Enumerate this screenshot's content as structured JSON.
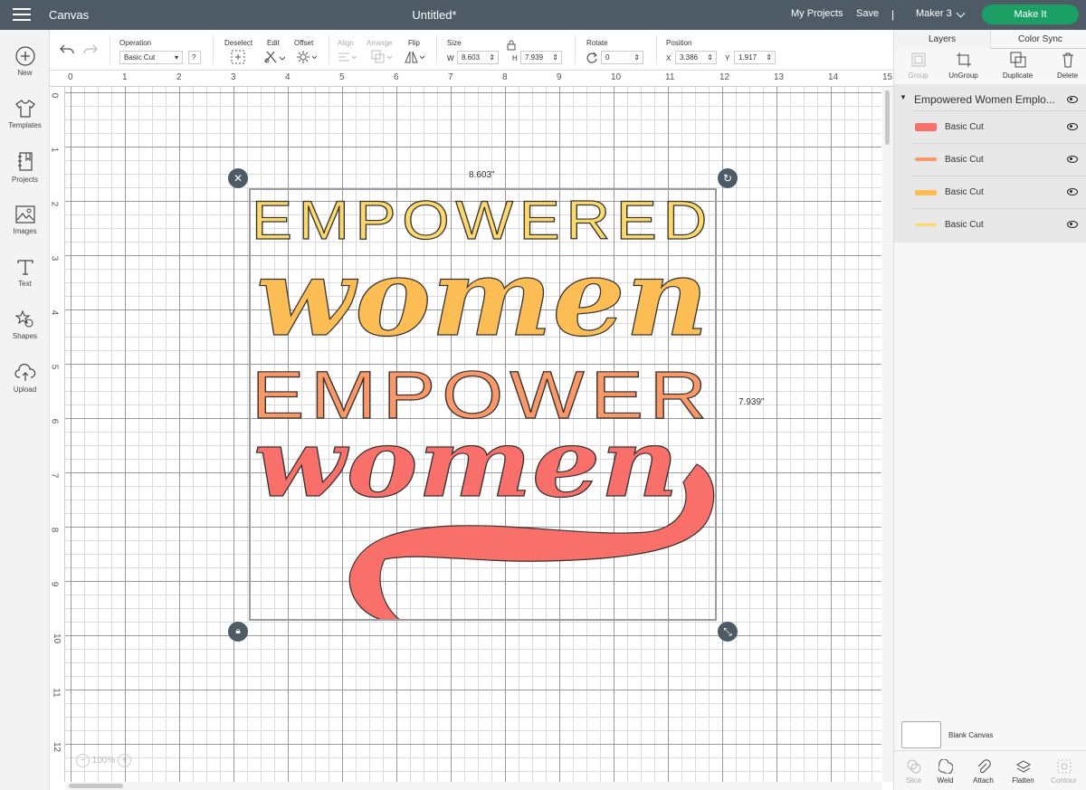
{
  "topbar": {
    "app_name": "Canvas",
    "doc_title": "Untitled*",
    "my_projects": "My Projects",
    "save": "Save",
    "separator": "|",
    "machine": "Maker 3",
    "make_it": "Make It"
  },
  "leftbar": {
    "items": [
      {
        "label": "New",
        "icon": "plus-icon"
      },
      {
        "label": "Templates",
        "icon": "tshirt-icon"
      },
      {
        "label": "Projects",
        "icon": "notebook-icon"
      },
      {
        "label": "Images",
        "icon": "image-icon"
      },
      {
        "label": "Text",
        "icon": "text-icon"
      },
      {
        "label": "Shapes",
        "icon": "shapes-icon"
      },
      {
        "label": "Upload",
        "icon": "upload-icon"
      }
    ]
  },
  "toolbar": {
    "operation_label": "Operation",
    "operation_value": "Basic Cut",
    "help": "?",
    "deselect_label": "Deselect",
    "edit_label": "Edit",
    "offset_label": "Offset",
    "align_label": "Align",
    "arrange_label": "Arrange",
    "flip_label": "Flip",
    "size_label": "Size",
    "w_label": "W",
    "w_value": "8.603",
    "h_label": "H",
    "h_value": "7.939",
    "rotate_label": "Rotate",
    "rotate_value": "0",
    "position_label": "Position",
    "x_label": "X",
    "x_value": "3.386",
    "y_label": "Y",
    "y_value": "1.917"
  },
  "rulers": {
    "h": [
      "0",
      "1",
      "2",
      "3",
      "4",
      "5",
      "6",
      "7",
      "8",
      "9",
      "10",
      "11",
      "12",
      "13",
      "14",
      "15"
    ],
    "v": [
      "0",
      "1",
      "2",
      "3",
      "4",
      "5",
      "6",
      "7",
      "8",
      "9",
      "10",
      "11",
      "12"
    ]
  },
  "canvas": {
    "width_dim": "8.603\"",
    "height_dim": "7.939\"",
    "zoom": "100%",
    "zoom_out": "−",
    "zoom_in": "+",
    "design": {
      "line1": "EMPOWERED",
      "line2": "women",
      "line3": "EMPOWER",
      "line4": "women",
      "colors": {
        "yellow": "#fcd96a",
        "orange": "#fcbd55",
        "peach": "#fb9868",
        "coral": "#f9706a"
      }
    }
  },
  "panel": {
    "tab_layers": "Layers",
    "tab_color_sync": "Color Sync",
    "actions": [
      {
        "label": "Group",
        "enabled": false
      },
      {
        "label": "UnGroup",
        "enabled": true
      },
      {
        "label": "Duplicate",
        "enabled": true
      },
      {
        "label": "Delete",
        "enabled": true
      }
    ],
    "group_name": "Empowered Women Emplo...",
    "layers": [
      {
        "label": "Basic Cut",
        "color": "#f9706a"
      },
      {
        "label": "Basic Cut",
        "color": "#fb9868"
      },
      {
        "label": "Basic Cut",
        "color": "#fcbd55"
      },
      {
        "label": "Basic Cut",
        "color": "#fcd96a"
      }
    ],
    "blank_canvas": "Blank Canvas",
    "bottom_actions": [
      {
        "label": "Slice",
        "enabled": false
      },
      {
        "label": "Weld",
        "enabled": true
      },
      {
        "label": "Attach",
        "enabled": true
      },
      {
        "label": "Flatten",
        "enabled": true
      },
      {
        "label": "Contour",
        "enabled": false
      }
    ]
  }
}
